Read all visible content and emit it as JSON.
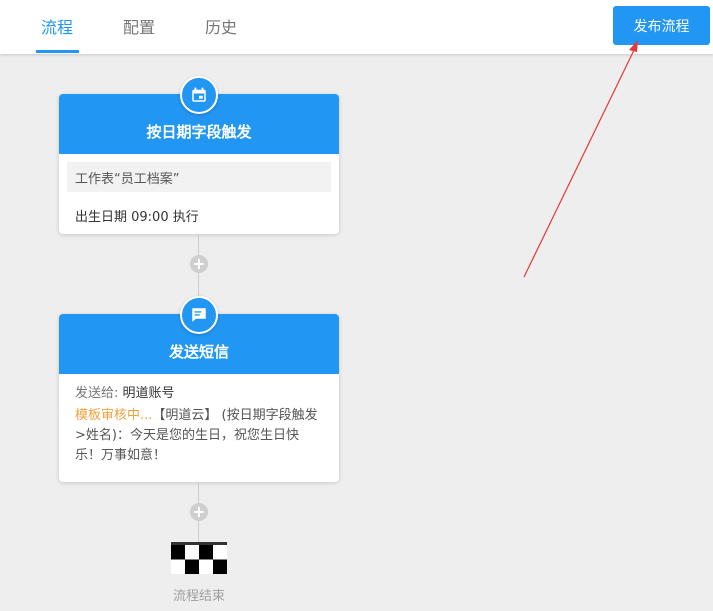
{
  "tabs": [
    {
      "label": "流程",
      "active": true
    },
    {
      "label": "配置",
      "active": false
    },
    {
      "label": "历史",
      "active": false
    }
  ],
  "publish_label": "发布流程",
  "colors": {
    "accent": "#2196f3",
    "pending": "#f0a23c",
    "annotation": "#e53935"
  },
  "trigger_node": {
    "icon": "calendar-icon",
    "title": "按日期字段触发",
    "worksheet": "工作表“员工档案”",
    "schedule": "出生日期  09:00  执行"
  },
  "sms_node": {
    "icon": "chat-icon",
    "title": "发送短信",
    "to_label": "发送给:",
    "to_value": "明道账号",
    "pending": "模板审核中...",
    "message": "【明道云】 (按日期字段触发>姓名)：今天是您的生日，祝您生日快乐！万事如意！"
  },
  "end": {
    "icon": "checkered-flag-icon",
    "label": "流程结束"
  }
}
